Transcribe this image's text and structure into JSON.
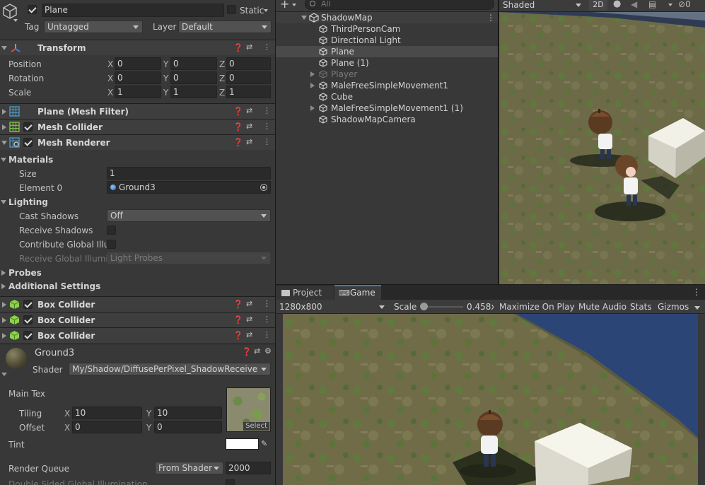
{
  "inspector": {
    "object_name": "Plane",
    "static_label": "Static",
    "tag_label": "Tag",
    "tag_value": "Untagged",
    "layer_label": "Layer",
    "layer_value": "Default",
    "transform": {
      "title": "Transform",
      "position_label": "Position",
      "rotation_label": "Rotation",
      "scale_label": "Scale",
      "axis_x": "X",
      "axis_y": "Y",
      "axis_z": "Z",
      "position": [
        "0",
        "0",
        "0"
      ],
      "rotation": [
        "0",
        "0",
        "0"
      ],
      "scale": [
        "1",
        "1",
        "1"
      ]
    },
    "mesh_filter_title": "Plane (Mesh Filter)",
    "mesh_collider_title": "Mesh Collider",
    "mesh_renderer": {
      "title": "Mesh Renderer",
      "materials_label": "Materials",
      "size_label": "Size",
      "size_value": "1",
      "element0_label": "Element 0",
      "element0_value": "Ground3",
      "lighting_label": "Lighting",
      "cast_shadows_label": "Cast Shadows",
      "cast_shadows_value": "Off",
      "receive_shadows_label": "Receive Shadows",
      "contribute_gi_label": "Contribute Global Illum",
      "receive_gi_label": "Receive Global Illumir",
      "receive_gi_value": "Light Probes",
      "probes_label": "Probes",
      "additional_settings_label": "Additional Settings"
    },
    "box_collider_title": "Box Collider",
    "material": {
      "name": "Ground3",
      "shader_label": "Shader",
      "shader_value": "My/Shadow/DiffusePerPixel_ShadowReceive",
      "main_tex_label": "Main Tex",
      "tiling_label": "Tiling",
      "offset_label": "Offset",
      "tiling": [
        "10",
        "10"
      ],
      "offset": [
        "0",
        "0"
      ],
      "select_label": "Select",
      "tint_label": "Tint",
      "render_queue_label": "Render Queue",
      "render_queue_mode": "From Shader",
      "render_queue_value": "2000",
      "double_sided_label": "Double Sided Global Illumination"
    }
  },
  "hierarchy": {
    "add_label": "+",
    "search_placeholder": "All",
    "scene_name": "ShadowMap",
    "items": [
      {
        "label": "ThirdPersonCam",
        "expandable": false,
        "selected": false,
        "dim": false
      },
      {
        "label": "Directional Light",
        "expandable": false,
        "selected": false,
        "dim": false
      },
      {
        "label": "Plane",
        "expandable": false,
        "selected": true,
        "dim": false
      },
      {
        "label": "Plane (1)",
        "expandable": false,
        "selected": false,
        "dim": false
      },
      {
        "label": "Player",
        "expandable": true,
        "selected": false,
        "dim": true
      },
      {
        "label": "MaleFreeSimpleMovement1",
        "expandable": true,
        "selected": false,
        "dim": false
      },
      {
        "label": "Cube",
        "expandable": false,
        "selected": false,
        "dim": false
      },
      {
        "label": "MaleFreeSimpleMovement1 (1)",
        "expandable": true,
        "selected": false,
        "dim": false
      },
      {
        "label": "ShadowMapCamera",
        "expandable": false,
        "selected": false,
        "dim": false
      }
    ]
  },
  "scene_toolbar": {
    "shading_mode": "Shaded",
    "mode_2d": "2D",
    "hidden_count": "0"
  },
  "game_panel": {
    "tab_project": "Project",
    "tab_game": "Game",
    "resolution": "1280x800",
    "scale_label": "Scale",
    "scale_value": "0.458x",
    "scale_level": 0.0,
    "maximize": "Maximize On Play",
    "mute": "Mute Audio",
    "stats": "Stats",
    "gizmos": "Gizmos"
  },
  "colors": {
    "panel": "#383838",
    "field": "#2a2a2a",
    "selected_row": "#4a4a4a",
    "water": "#2b4577",
    "grass": "#6f6c46"
  }
}
